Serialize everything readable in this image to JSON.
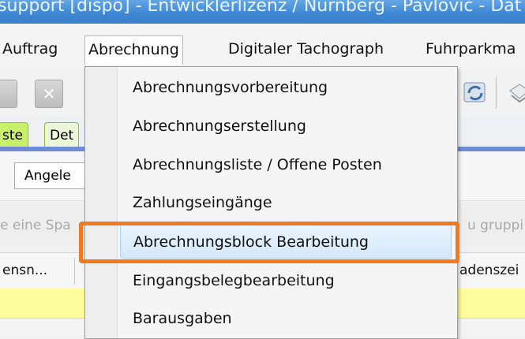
{
  "window": {
    "title": "support [dispo] - Entwicklerlizenz / Nürnberg - Pavlovic - Dat"
  },
  "menubar": {
    "items": [
      {
        "label": "Auftrag"
      },
      {
        "label": "Abrechnung"
      },
      {
        "label": "Digitaler Tachograph"
      },
      {
        "label": "Fuhrparkma"
      }
    ]
  },
  "tabs": [
    {
      "label": "ste"
    },
    {
      "label": "Det"
    }
  ],
  "filter": {
    "value": "Angele"
  },
  "grouphint": {
    "left_text": "e eine Spa",
    "right_text": "u gruppi"
  },
  "grid": {
    "headers": [
      {
        "label": "ensn..."
      },
      {
        "label": "adenszei"
      }
    ]
  },
  "dropdown": {
    "items": [
      {
        "label": "Abrechnungsvorbereitung"
      },
      {
        "label": "Abrechnungserstellung"
      },
      {
        "label": "Abrechnungsliste / Offene Posten"
      },
      {
        "label": "Zahlungseingänge"
      },
      {
        "label": "Abrechnungsblock Bearbeitung"
      },
      {
        "label": "Eingangsbelegbearbeitung"
      },
      {
        "label": "Barausgaben"
      }
    ]
  },
  "colors": {
    "highlight": "#ef7a22",
    "active_tab": "#c8f06b",
    "row_highlight": "#fefd9d",
    "hover": "#d3e8fb"
  }
}
